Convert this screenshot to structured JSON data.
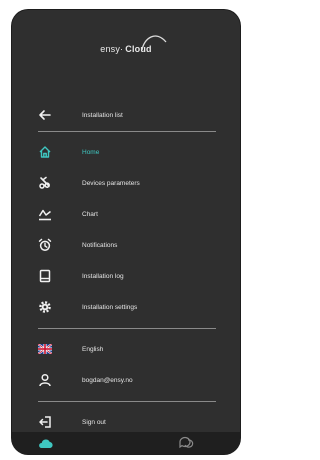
{
  "app": {
    "logo_prefix": "ensy·",
    "logo_suffix": "Cloud"
  },
  "menu": {
    "back_label": "Installation list",
    "items": [
      {
        "label": "Home",
        "icon": "home-icon",
        "active": true
      },
      {
        "label": "Devices parameters",
        "icon": "device-params-icon",
        "active": false
      },
      {
        "label": "Chart",
        "icon": "chart-icon",
        "active": false
      },
      {
        "label": "Notifications",
        "icon": "alarm-clock-icon",
        "active": false
      },
      {
        "label": "Installation log",
        "icon": "book-icon",
        "active": false
      },
      {
        "label": "Installation settings",
        "icon": "gear-icon",
        "active": false
      }
    ],
    "language": "English",
    "user_email": "bogdan@ensy.no",
    "sign_out": "Sign out"
  },
  "colors": {
    "accent": "#3fc7c1",
    "background": "#2f2f2f",
    "separator": "#8a8a8a",
    "flag_red": "#c8102e",
    "flag_blue": "#1f3f8f"
  }
}
